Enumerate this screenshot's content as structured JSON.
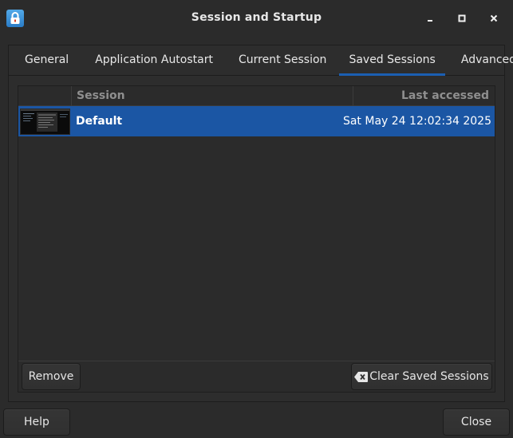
{
  "window": {
    "title": "Session and Startup",
    "icon": "lock-icon",
    "controls": {
      "minimize": "minimize-icon",
      "maximize": "maximize-icon",
      "close": "close-icon"
    }
  },
  "tabs": [
    {
      "label": "General",
      "active": false
    },
    {
      "label": "Application Autostart",
      "active": false
    },
    {
      "label": "Current Session",
      "active": false
    },
    {
      "label": "Saved Sessions",
      "active": true
    },
    {
      "label": "Advanced",
      "active": false
    }
  ],
  "sessions": {
    "columns": {
      "session": "Session",
      "last_accessed": "Last accessed"
    },
    "rows": [
      {
        "name": "Default",
        "last_accessed": "Sat May 24 12:02:34 2025",
        "selected": true
      }
    ],
    "remove_label": "Remove",
    "clear_label": "Clear Saved Sessions",
    "clear_icon": "clear-backspace-icon"
  },
  "footer": {
    "help_label": "Help",
    "close_label": "Close"
  },
  "colors": {
    "accent": "#1b56a4",
    "background": "#2b2b2b",
    "tab_indicator": "#1b5fb3"
  }
}
